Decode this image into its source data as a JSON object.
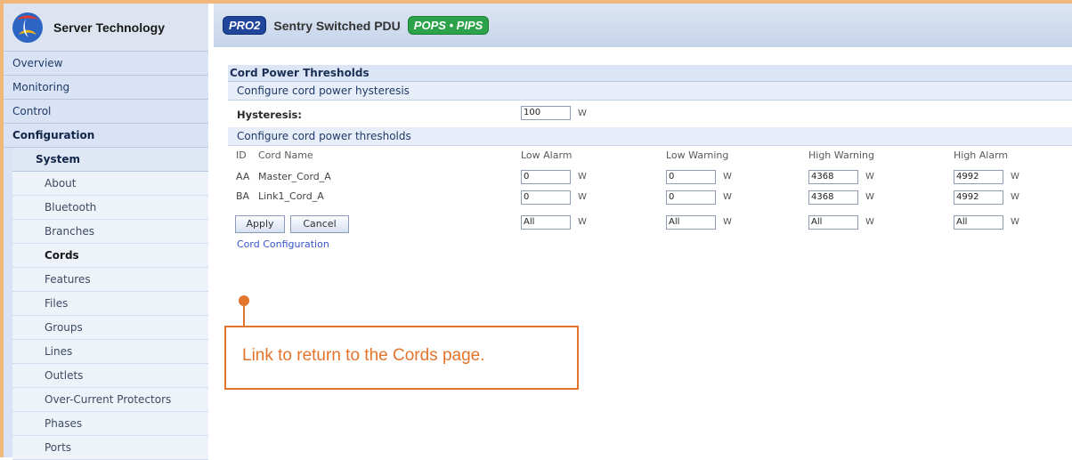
{
  "brand": {
    "name": "Server Technology",
    "logo_icon": "server-technology-logo"
  },
  "header": {
    "badge_left": "PRO",
    "badge_left_digit": "2",
    "product": "Sentry Switched PDU",
    "badge_right": "POPS • PIPS"
  },
  "sidebar": {
    "items": [
      {
        "label": "Overview"
      },
      {
        "label": "Monitoring"
      },
      {
        "label": "Control"
      },
      {
        "label": "Configuration"
      }
    ],
    "system_header": "System",
    "sub_items": [
      {
        "label": "About"
      },
      {
        "label": "Bluetooth"
      },
      {
        "label": "Branches"
      },
      {
        "label": "Cords"
      },
      {
        "label": "Features"
      },
      {
        "label": "Files"
      },
      {
        "label": "Groups"
      },
      {
        "label": "Lines"
      },
      {
        "label": "Outlets"
      },
      {
        "label": "Over-Current Protectors"
      },
      {
        "label": "Phases"
      },
      {
        "label": "Ports"
      }
    ]
  },
  "page": {
    "title": "Cord Power Thresholds",
    "hysteresis_section": "Configure cord power hysteresis",
    "hysteresis_label": "Hysteresis:",
    "hysteresis_value": "100",
    "unit": "W",
    "threshold_section": "Configure cord power thresholds",
    "columns": {
      "id": "ID",
      "cord_name": "Cord Name",
      "low_alarm": "Low Alarm",
      "low_warning": "Low Warning",
      "high_warning": "High Warning",
      "high_alarm": "High Alarm"
    },
    "rows": [
      {
        "id": "AA",
        "name": "Master_Cord_A",
        "low_alarm": "0",
        "low_warning": "0",
        "high_warning": "4368",
        "high_alarm": "4992"
      },
      {
        "id": "BA",
        "name": "Link1_Cord_A",
        "low_alarm": "0",
        "low_warning": "0",
        "high_warning": "4368",
        "high_alarm": "4992"
      }
    ],
    "all_values": {
      "low_alarm": "All",
      "low_warning": "All",
      "high_warning": "All",
      "high_alarm": "All"
    },
    "apply_label": "Apply",
    "cancel_label": "Cancel",
    "link_label": "Cord Configuration"
  },
  "callout": {
    "text": "Link to return to the Cords page.",
    "color": "#e3742b"
  }
}
